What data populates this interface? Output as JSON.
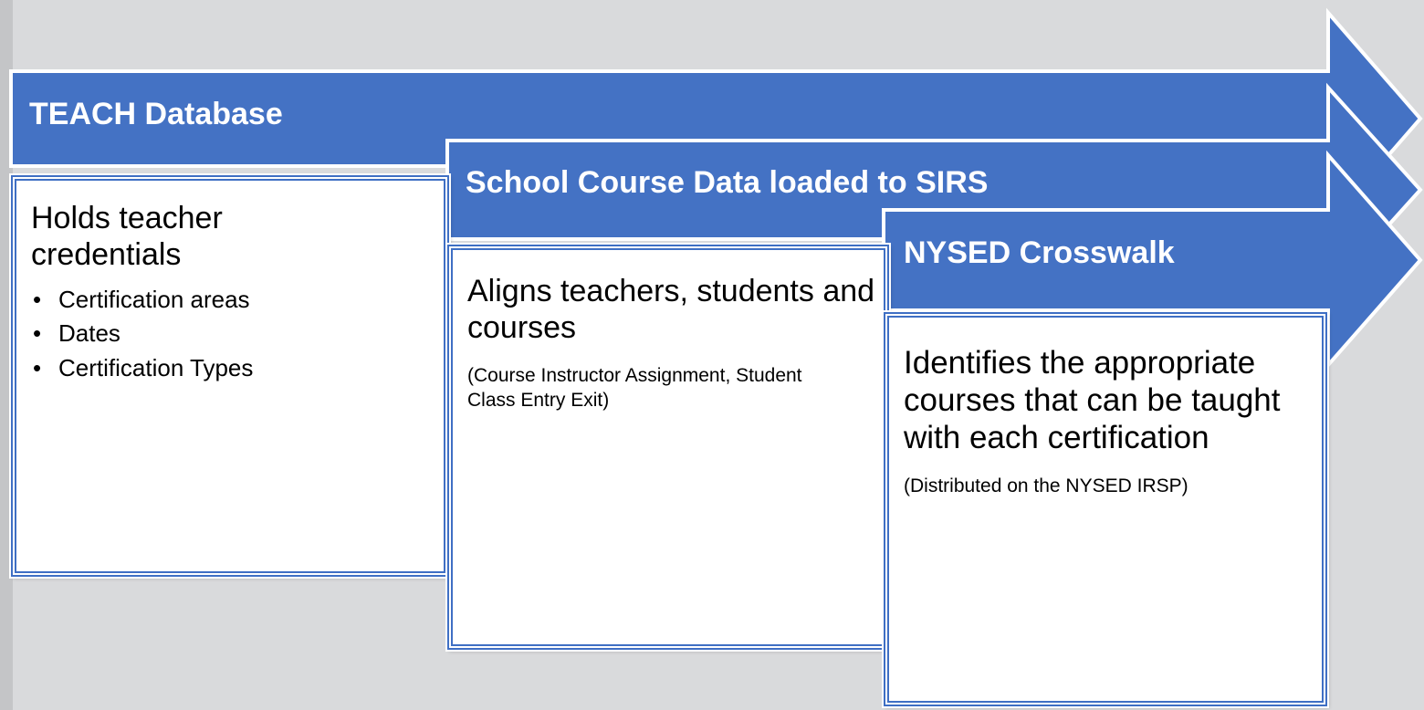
{
  "colors": {
    "background": "#d9dadc",
    "arrow_fill": "#4472c4",
    "arrow_stroke": "#ffffff",
    "box_border": "#3f6fc4",
    "box_fill": "#ffffff"
  },
  "stages": [
    {
      "title": "TEACH Database",
      "heading": "Holds teacher credentials",
      "items": [
        "Certification areas",
        "Dates",
        "Certification Types"
      ],
      "note": ""
    },
    {
      "title": "School Course Data loaded to SIRS",
      "heading": "Aligns teachers, students and courses",
      "items": [],
      "note": "(Course Instructor Assignment, Student Class Entry Exit)"
    },
    {
      "title": "NYSED Crosswalk",
      "heading": "Identifies the appropriate courses that can be taught with each certification",
      "items": [],
      "note": "(Distributed on the NYSED IRSP)"
    }
  ]
}
